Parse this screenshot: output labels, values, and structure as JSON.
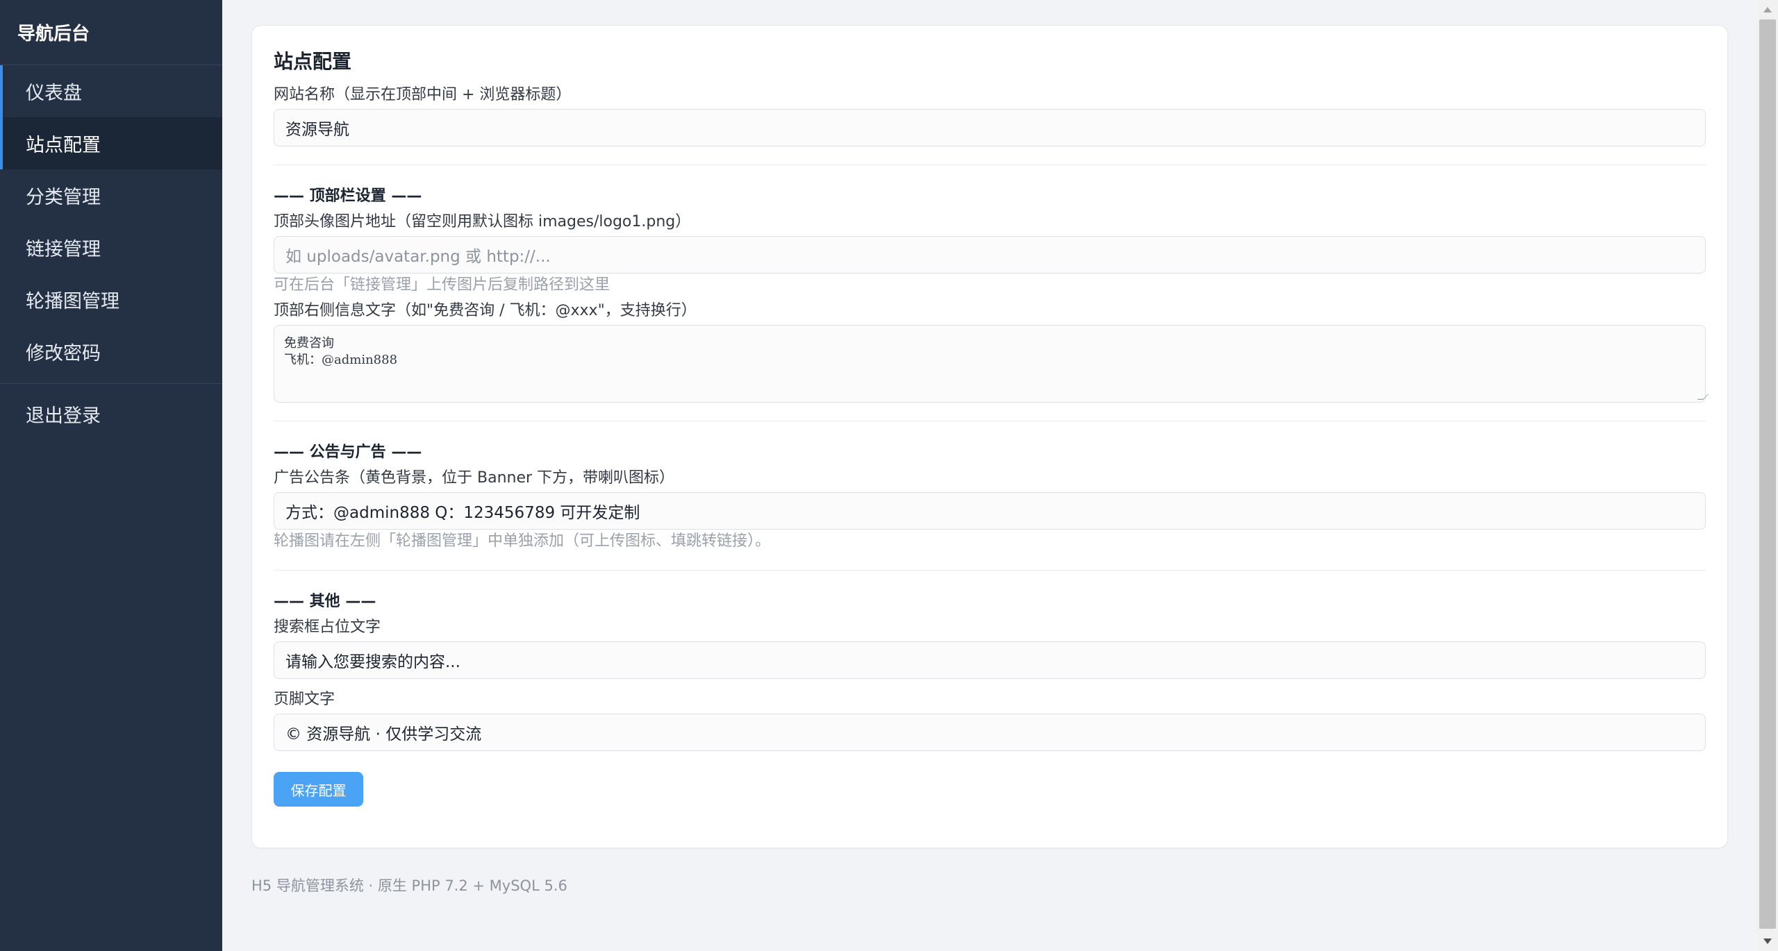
{
  "sidebar": {
    "brand": "导航后台",
    "items": [
      {
        "label": "仪表盘"
      },
      {
        "label": "站点配置"
      },
      {
        "label": "分类管理"
      },
      {
        "label": "链接管理"
      },
      {
        "label": "轮播图管理"
      },
      {
        "label": "修改密码"
      }
    ],
    "logout": "退出登录"
  },
  "card": {
    "title": "站点配置",
    "site_name": {
      "label": "网站名称（显示在顶部中间 + 浏览器标题）",
      "value": "资源导航"
    },
    "topbar": {
      "section_title": "—— 顶部栏设置 ——",
      "avatar_label": "顶部头像图片地址（留空则用默认图标 images/logo1.png）",
      "avatar_placeholder": "如 uploads/avatar.png 或 http://...",
      "avatar_hint": "可在后台「链接管理」上传图片后复制路径到这里",
      "info_label": "顶部右侧信息文字（如\"免费咨询 / 飞机：@xxx\"，支持换行）",
      "info_line1": "免费咨询",
      "info_line2": "飞机：@admin888"
    },
    "ads": {
      "section_title": "—— 公告与广告 ——",
      "notice_label": "广告公告条（黄色背景，位于 Banner 下方，带喇叭图标）",
      "notice_value": "方式：@admin888 Q：123456789 可开发定制",
      "notice_hint": "轮播图请在左侧「轮播图管理」中单独添加（可上传图标、填跳转链接）。"
    },
    "other": {
      "section_title": "—— 其他 ——",
      "search_label": "搜索框占位文字",
      "search_value": "请输入您要搜索的内容...",
      "footer_label": "页脚文字",
      "footer_value": "© 资源导航 · 仅供学习交流"
    },
    "save_label": "保存配置"
  },
  "footer_note": "H5 导航管理系统 · 原生 PHP 7.2 + MySQL 5.6",
  "colors": {
    "sidebar_bg": "#243144",
    "accent": "#3b8ee8",
    "button": "#4aa3f5"
  }
}
